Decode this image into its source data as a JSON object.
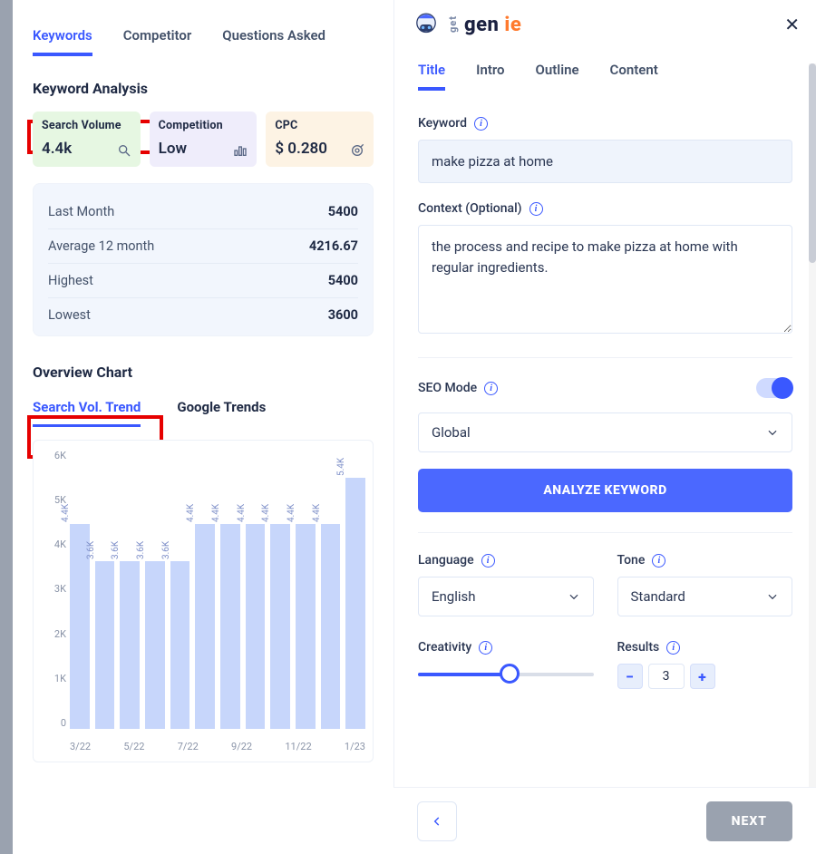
{
  "left_tabs": {
    "keywords": "Keywords",
    "competitor": "Competitor",
    "questions": "Questions Asked"
  },
  "keyword_analysis_title": "Keyword Analysis",
  "cards": {
    "volume": {
      "label": "Search Volume",
      "value": "4.4k"
    },
    "competition": {
      "label": "Competition",
      "value": "Low"
    },
    "cpc": {
      "label": "CPC",
      "value": "$ 0.280"
    }
  },
  "stats": [
    {
      "k": "Last Month",
      "v": "5400"
    },
    {
      "k": "Average 12 month",
      "v": "4216.67"
    },
    {
      "k": "Highest",
      "v": "5400"
    },
    {
      "k": "Lowest",
      "v": "3600"
    }
  ],
  "overview_title": "Overview Chart",
  "subtabs": {
    "trend": "Search Vol. Trend",
    "gtrends": "Google Trends"
  },
  "chart_data": {
    "type": "bar",
    "ymax": 6000,
    "yticks": [
      "6K",
      "5K",
      "4K",
      "3K",
      "2K",
      "1K",
      "0"
    ],
    "categories": [
      "3/22",
      "4/22",
      "5/22",
      "6/22",
      "7/22",
      "8/22",
      "9/22",
      "10/22",
      "11/22",
      "12/22",
      "1/23",
      "2/23"
    ],
    "xticks": [
      "3/22",
      "5/22",
      "7/22",
      "9/22",
      "11/22",
      "1/23"
    ],
    "values": [
      4400,
      3600,
      3600,
      3600,
      3600,
      4400,
      4400,
      4400,
      4400,
      4400,
      4400,
      5400
    ],
    "labels": [
      "4.4K",
      "3.6K",
      "3.6K",
      "3.6K",
      "3.6K",
      "4.4K",
      "4.4K",
      "4.4K",
      "4.4K",
      "4.4K",
      "4.4K",
      "5.4K"
    ]
  },
  "right": {
    "brand_a": "get",
    "brand_b": "gen",
    "brand_c": "ie",
    "tabs": {
      "title": "Title",
      "intro": "Intro",
      "outline": "Outline",
      "content": "Content"
    },
    "keyword_label": "Keyword",
    "keyword_value": "make pizza at home",
    "context_label": "Context (Optional)",
    "context_value": "the process and recipe to make pizza at home with regular ingredients.",
    "seo_label": "SEO Mode",
    "region_value": "Global",
    "analyze_btn": "ANALYZE KEYWORD",
    "language_label": "Language",
    "language_value": "English",
    "tone_label": "Tone",
    "tone_value": "Standard",
    "creativity_label": "Creativity",
    "creativity_pct": 52,
    "results_label": "Results",
    "results_value": "3",
    "next": "NEXT"
  }
}
